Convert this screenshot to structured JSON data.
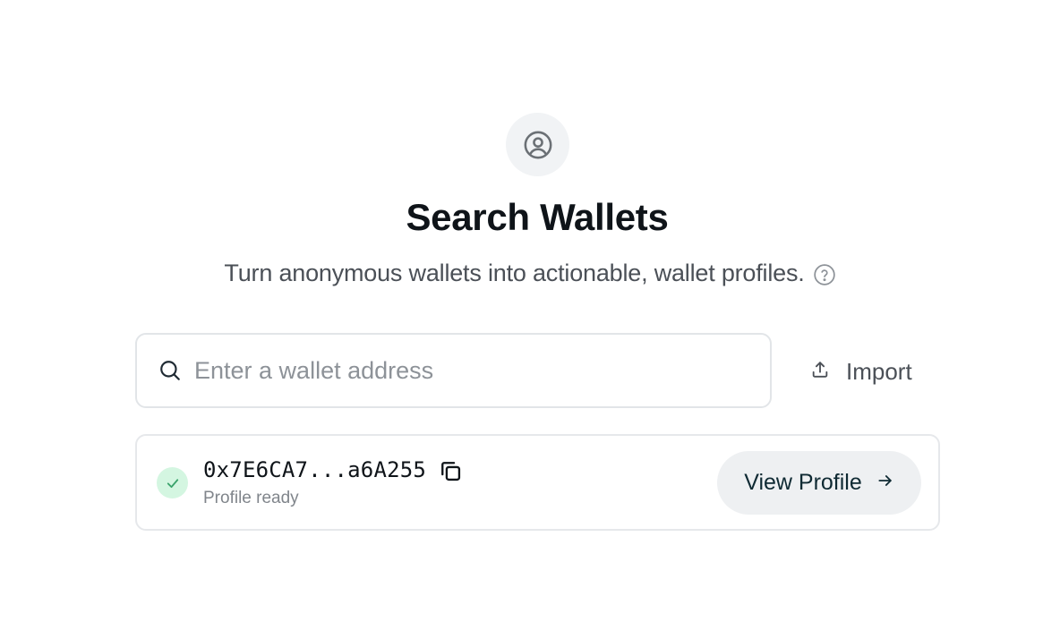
{
  "header": {
    "title": "Search Wallets",
    "subtitle": "Turn anonymous wallets into actionable, wallet profiles.",
    "hero_icon": "user-circle-icon",
    "help_icon": "question-circle-icon"
  },
  "search": {
    "placeholder": "Enter a wallet address",
    "value": "",
    "icon": "search-icon"
  },
  "import_button": {
    "label": "Import",
    "icon": "upload-icon"
  },
  "result": {
    "address": "0x7E6CA7...a6A255",
    "status": "Profile ready",
    "status_icon": "check-icon",
    "copy_icon": "copy-icon",
    "action_label": "View Profile",
    "action_icon": "arrow-right-icon"
  },
  "colors": {
    "accent_success_bg": "#d4f6e1",
    "accent_success": "#3aa36b",
    "button_bg": "#eef0f2",
    "text_primary": "#0f1419",
    "text_secondary": "#4b5057",
    "border": "#e2e5e8"
  }
}
